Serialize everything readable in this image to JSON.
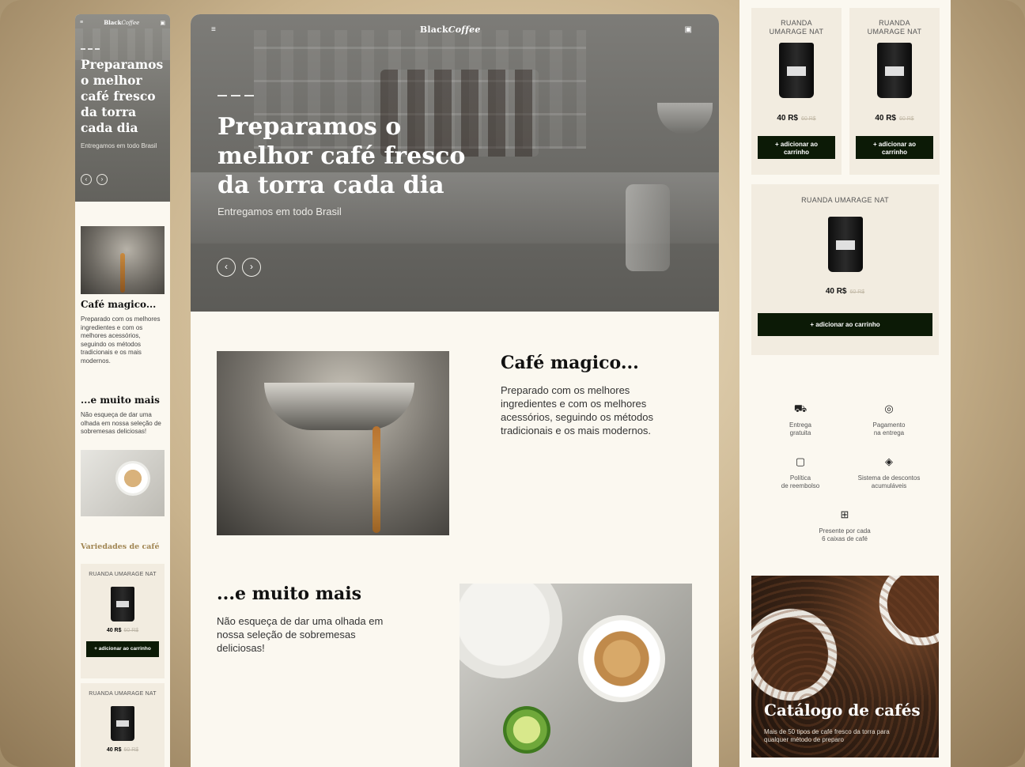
{
  "brand": {
    "logo_plain": "Black",
    "logo_italic": "Coffee"
  },
  "hero": {
    "title": "Preparamos o melhor café fresco da torra cada dia",
    "subtitle": "Entregamos em todo Brasil",
    "prev": "‹",
    "next": "›"
  },
  "section1": {
    "title": "Café magico...",
    "text": "Preparado com os melhores ingredientes e com os melhores acessórios, seguindo os métodos tradicionais e os mais modernos."
  },
  "section2": {
    "title": "...e muito mais",
    "text": "Não esqueça de dar uma olhada em nossa seleção de sobremesas deliciosas!"
  },
  "varieties": {
    "title": "Variedades de café"
  },
  "product": {
    "name": "RUANDA UMARAGE NAT",
    "name_line1": "RUANDA",
    "name_line2": "UMARAGE NAT",
    "price": "40 R$",
    "old_price": "60 R$",
    "button": "+ adicionar ao carrinho",
    "button_line1": "+ adicionar ao",
    "button_line2": "carrinho"
  },
  "features": [
    {
      "icon": "truck-icon",
      "line1": "Entrega",
      "line2": "gratuita"
    },
    {
      "icon": "coffee-bean-icon",
      "line1": "Pagamento",
      "line2": "na entrega"
    },
    {
      "icon": "wallet-icon",
      "line1": "Política",
      "line2": "de reembolso"
    },
    {
      "icon": "discount-tag-icon",
      "line1": "Sistema de descontos",
      "line2": "acumuláveis"
    },
    {
      "icon": "gift-icon",
      "line1": "Presente por cada",
      "line2": "6 caixas de café"
    }
  ],
  "catalog": {
    "title": "Catálogo de cafés",
    "text": "Mais de 50 tipos de café fresco da torra para qualquer método de preparo"
  },
  "colors": {
    "button": "#0c1a06",
    "card": "#f2ece0",
    "page": "#fbf8f0",
    "accent": "#a18653"
  }
}
